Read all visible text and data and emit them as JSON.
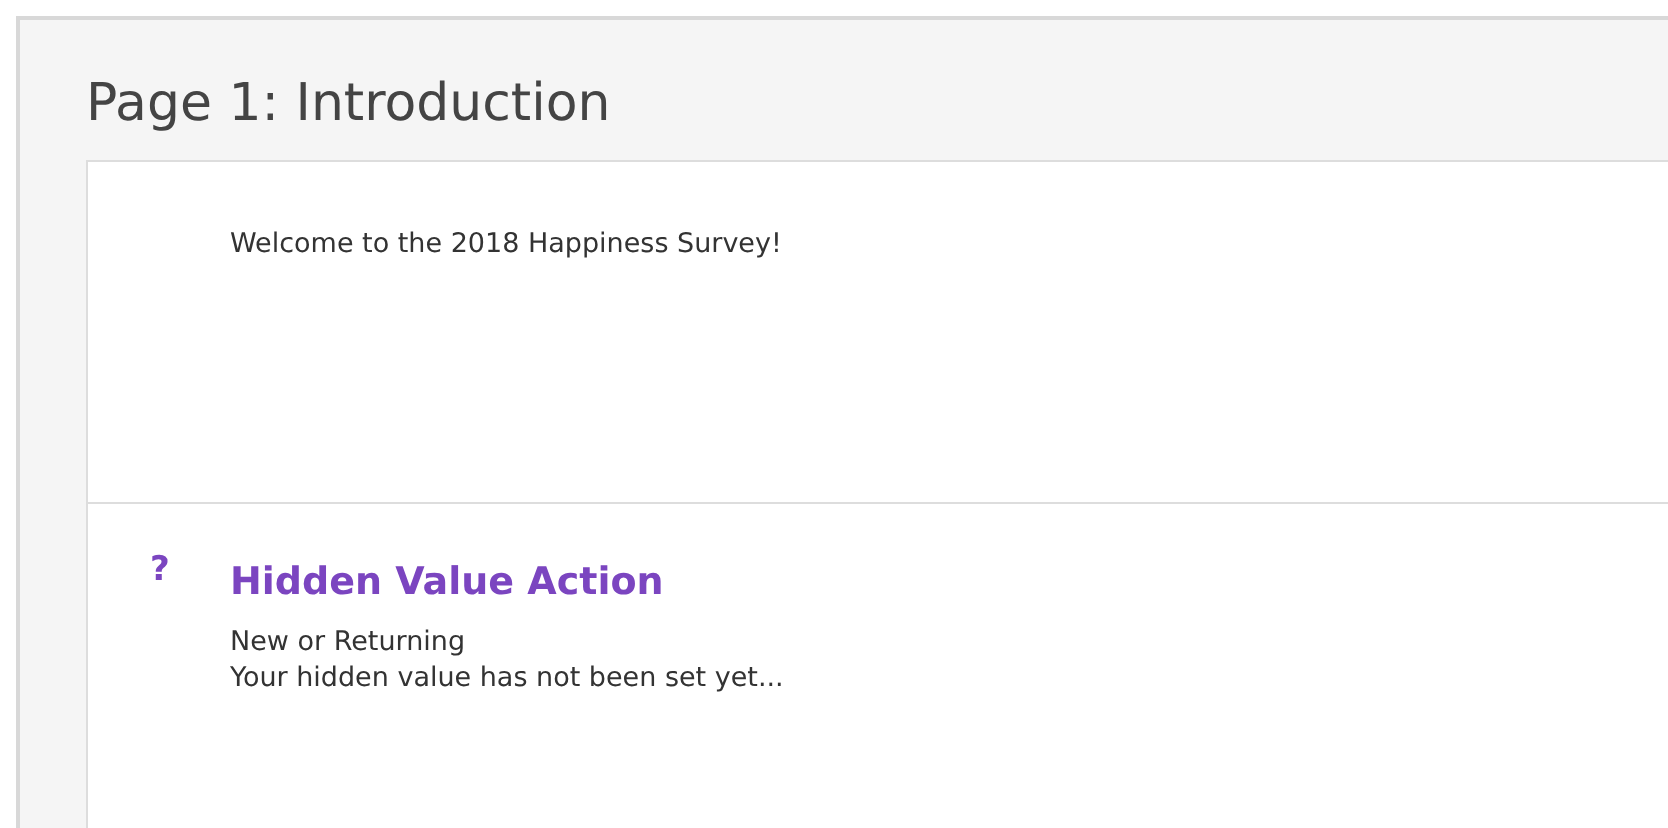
{
  "page": {
    "title": "Page 1: Introduction"
  },
  "sections": [
    {
      "kind": "text",
      "text": "Welcome to the 2018 Happiness Survey!"
    },
    {
      "kind": "action",
      "marker": "?",
      "title": "Hidden Value Action",
      "lines": [
        "New or Returning",
        "Your hidden value has not been set yet..."
      ]
    }
  ]
}
